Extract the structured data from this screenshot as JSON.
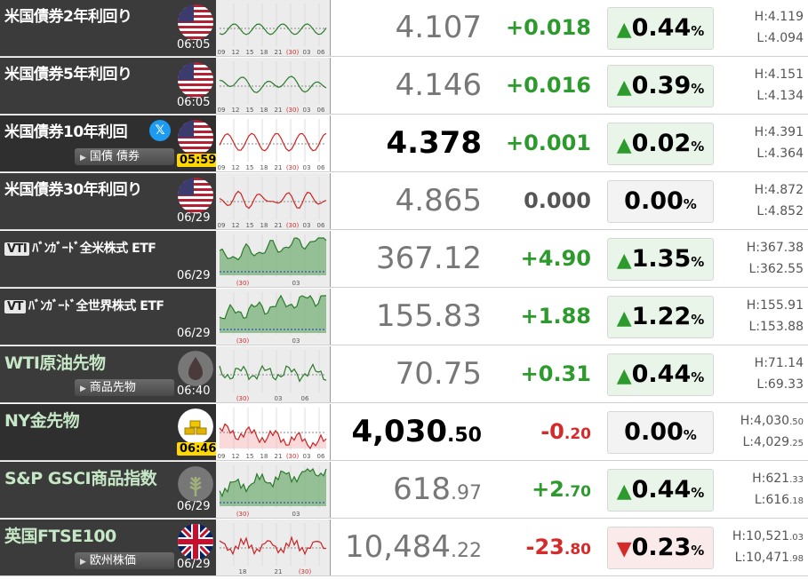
{
  "rows": [
    {
      "name": "米国債券2年利回り",
      "time": "06:05",
      "flag": "us-flag-icon",
      "price": "4.107",
      "price_dec": "",
      "change": "+0.018",
      "change_dec": "",
      "dir": "up",
      "pct": "0.44",
      "high": "H:4.119",
      "high_dec": "",
      "low": "L:4.094",
      "low_dec": "",
      "ticks": [
        "09",
        "12",
        "15",
        "18",
        "21",
        "(30)",
        "03",
        "06"
      ]
    },
    {
      "name": "米国債券5年利回り",
      "time": "06:05",
      "flag": "us-flag-icon",
      "price": "4.146",
      "price_dec": "",
      "change": "+0.016",
      "change_dec": "",
      "dir": "up",
      "pct": "0.39",
      "high": "H:4.151",
      "high_dec": "",
      "low": "L:4.134",
      "low_dec": "",
      "ticks": [
        "09",
        "12",
        "15",
        "18",
        "21",
        "(30)",
        "03",
        "06"
      ]
    },
    {
      "name": "米国債券10年利回",
      "time": "05:59",
      "flag": "us-flag-icon",
      "badge": "国債 債券",
      "price": "4.378",
      "price_dec": "",
      "change": "+0.001",
      "change_dec": "",
      "dir": "up",
      "pct": "0.02",
      "high": "H:4.391",
      "high_dec": "",
      "low": "L:4.364",
      "low_dec": "",
      "ticks": [
        "09",
        "12",
        "15",
        "18",
        "21",
        "(30)",
        "03",
        "06"
      ]
    },
    {
      "name": "米国債券30年利回り",
      "time": "06/29",
      "flag": "us-flag-icon",
      "price": "4.865",
      "price_dec": "",
      "change": "0.000",
      "change_dec": "",
      "dir": "flat",
      "pct": "0.00",
      "high": "H:4.872",
      "high_dec": "",
      "low": "L:4.852",
      "low_dec": "",
      "ticks": [
        "09",
        "12",
        "15",
        "18",
        "21",
        "(30)",
        "03",
        "06"
      ]
    },
    {
      "name": "ﾊﾞﾝｶﾞｰﾄﾞ全米株式 ETF",
      "vt": "VTI",
      "time": "06/29",
      "price": "367.12",
      "price_dec": "",
      "change": "+4.90",
      "change_dec": "",
      "dir": "up",
      "pct": "1.35",
      "high": "H:367.38",
      "high_dec": "",
      "low": "L:362.55",
      "low_dec": "",
      "ticks": [
        "(30)",
        "03"
      ]
    },
    {
      "name": "ﾊﾞﾝｶﾞｰﾄﾞ全世界株式 ETF",
      "vt": "VT",
      "time": "06/29",
      "price": "155.83",
      "price_dec": "",
      "change": "+1.88",
      "change_dec": "",
      "dir": "up",
      "pct": "1.22",
      "high": "H:155.91",
      "high_dec": "",
      "low": "L:153.88",
      "low_dec": "",
      "ticks": [
        "(30)",
        "03"
      ]
    },
    {
      "name": "WTI原油先物",
      "time": "06:40",
      "badge": "商品先物",
      "price": "70.75",
      "price_dec": "",
      "change": "+0.31",
      "change_dec": "",
      "dir": "up",
      "pct": "0.44",
      "high": "H:71.14",
      "high_dec": "",
      "low": "L:69.33",
      "low_dec": "",
      "ticks": [
        "(30)",
        "03",
        "06"
      ]
    },
    {
      "name": "NY金先物",
      "time": "06:46",
      "price": "4,030",
      "price_dec": ".50",
      "change": "-0",
      "change_dec": ".20",
      "dir": "flat",
      "pct": "0.00",
      "high": "H:4,030",
      "high_dec": ".50",
      "low": "L:4,029",
      "low_dec": ".25",
      "ticks": [
        "09",
        "12",
        "15",
        "18",
        "21",
        "(30)",
        "03",
        "06"
      ]
    },
    {
      "name": "S&P GSCI商品指数",
      "time": "06/29",
      "price": "618",
      "price_dec": ".97",
      "change": "+2",
      "change_dec": ".70",
      "dir": "up",
      "pct": "0.44",
      "high": "H:621",
      "high_dec": ".33",
      "low": "L:616",
      "low_dec": ".18",
      "ticks": [
        "(30)",
        "03"
      ]
    },
    {
      "name": "英国FTSE100",
      "time": "06/29",
      "badge": "欧州株価",
      "price": "10,484",
      "price_dec": ".22",
      "change": "-23",
      "change_dec": ".80",
      "dir": "down",
      "pct": "0.23",
      "high": "H:10,521",
      "high_dec": ".03",
      "low": "L:10,471",
      "low_dec": ".98",
      "ticks": [
        "18",
        "21",
        "(30)"
      ]
    }
  ],
  "pct_suffix": "%",
  "colors": {
    "up": "#2c9a2c",
    "down": "#d42a2a",
    "panel": "#3b3b3b",
    "gold": "#ffd800"
  }
}
